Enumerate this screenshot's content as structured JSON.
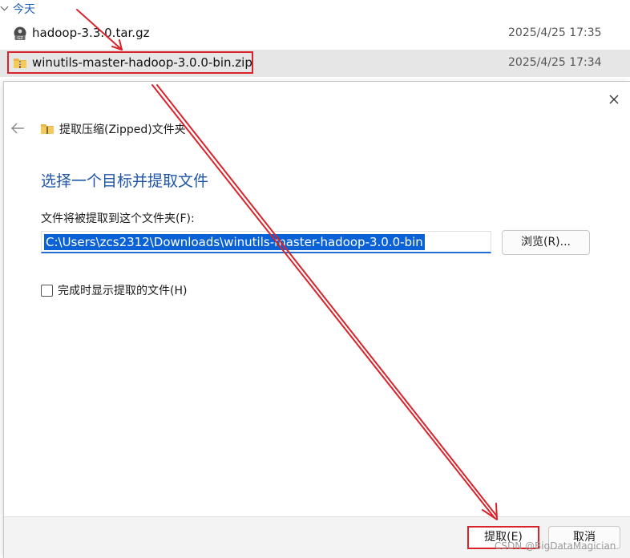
{
  "explorer": {
    "group_label": "今天",
    "files": [
      {
        "name": "hadoop-3.3.0.tar.gz",
        "date": "2025/4/25 17:35",
        "icon": "gz-archive-icon"
      },
      {
        "name": "winutils-master-hadoop-3.0.0-bin.zip",
        "date": "2025/4/25 17:34",
        "icon": "zip-folder-icon"
      }
    ]
  },
  "dialog": {
    "title": "提取压缩(Zipped)文件夹",
    "heading": "选择一个目标并提取文件",
    "path_label": "文件将被提取到这个文件夹(F):",
    "path_value": "C:\\Users\\zcs2312\\Downloads\\winutils-master-hadoop-3.0.0-bin",
    "browse_label": "浏览(R)...",
    "checkbox_label": "完成时显示提取的文件(H)",
    "checkbox_checked": false,
    "extract_label": "提取(E)",
    "cancel_label": "取消"
  },
  "watermark": "CSDN @BigDataMagician",
  "colors": {
    "accent_blue": "#1f56a8",
    "selection_blue": "#0a62d6",
    "annotation_red": "#d9232b"
  }
}
